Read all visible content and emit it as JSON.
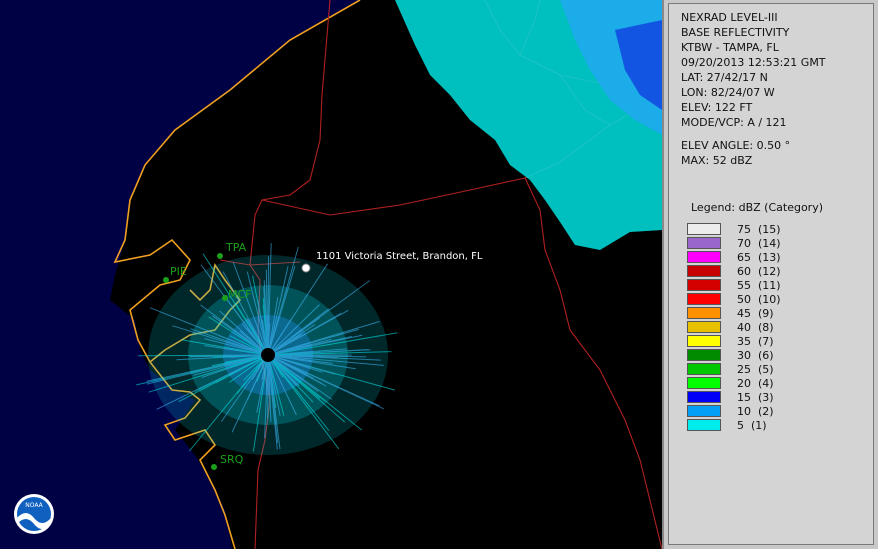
{
  "info": {
    "product": "NEXRAD LEVEL-III",
    "type": "BASE REFLECTIVITY",
    "station": "KTBW - TAMPA, FL",
    "datetime": "09/20/2013 12:53:21 GMT",
    "lat": "LAT: 27/42/17 N",
    "lon": "LON: 82/24/07 W",
    "elev": "ELEV: 122 FT",
    "mode": "MODE/VCP: A / 121",
    "elev_angle": "ELEV ANGLE: 0.50 °",
    "max": "MAX: 52 dBZ"
  },
  "legend": {
    "title": "Legend: dBZ (Category)",
    "items": [
      {
        "label": "75  (15)",
        "color": "#ececec"
      },
      {
        "label": "70  (14)",
        "color": "#9966cc"
      },
      {
        "label": "65  (13)",
        "color": "#ff00ff"
      },
      {
        "label": "60  (12)",
        "color": "#c80000"
      },
      {
        "label": "55  (11)",
        "color": "#d40000"
      },
      {
        "label": "50  (10)",
        "color": "#ff0000"
      },
      {
        "label": "45  (9)",
        "color": "#ff9000"
      },
      {
        "label": "40  (8)",
        "color": "#e7c000"
      },
      {
        "label": "35  (7)",
        "color": "#ffff00"
      },
      {
        "label": "30  (6)",
        "color": "#008c00"
      },
      {
        "label": "25  (5)",
        "color": "#00c800"
      },
      {
        "label": "20  (4)",
        "color": "#00ff00"
      },
      {
        "label": "15  (3)",
        "color": "#0000f6"
      },
      {
        "label": "10  (2)",
        "color": "#01a0f6"
      },
      {
        "label": "5  (1)",
        "color": "#00ecec"
      }
    ]
  },
  "map": {
    "location_label": "1101 Victoria Street, Brandon, FL",
    "cities": [
      "TPA",
      "PIE",
      "MCF",
      "SRQ"
    ],
    "logo_text": "NOAA",
    "colors": {
      "gulf": "#000045",
      "land": "#000000",
      "coast": "#f0a020",
      "county": "#b02020"
    }
  }
}
